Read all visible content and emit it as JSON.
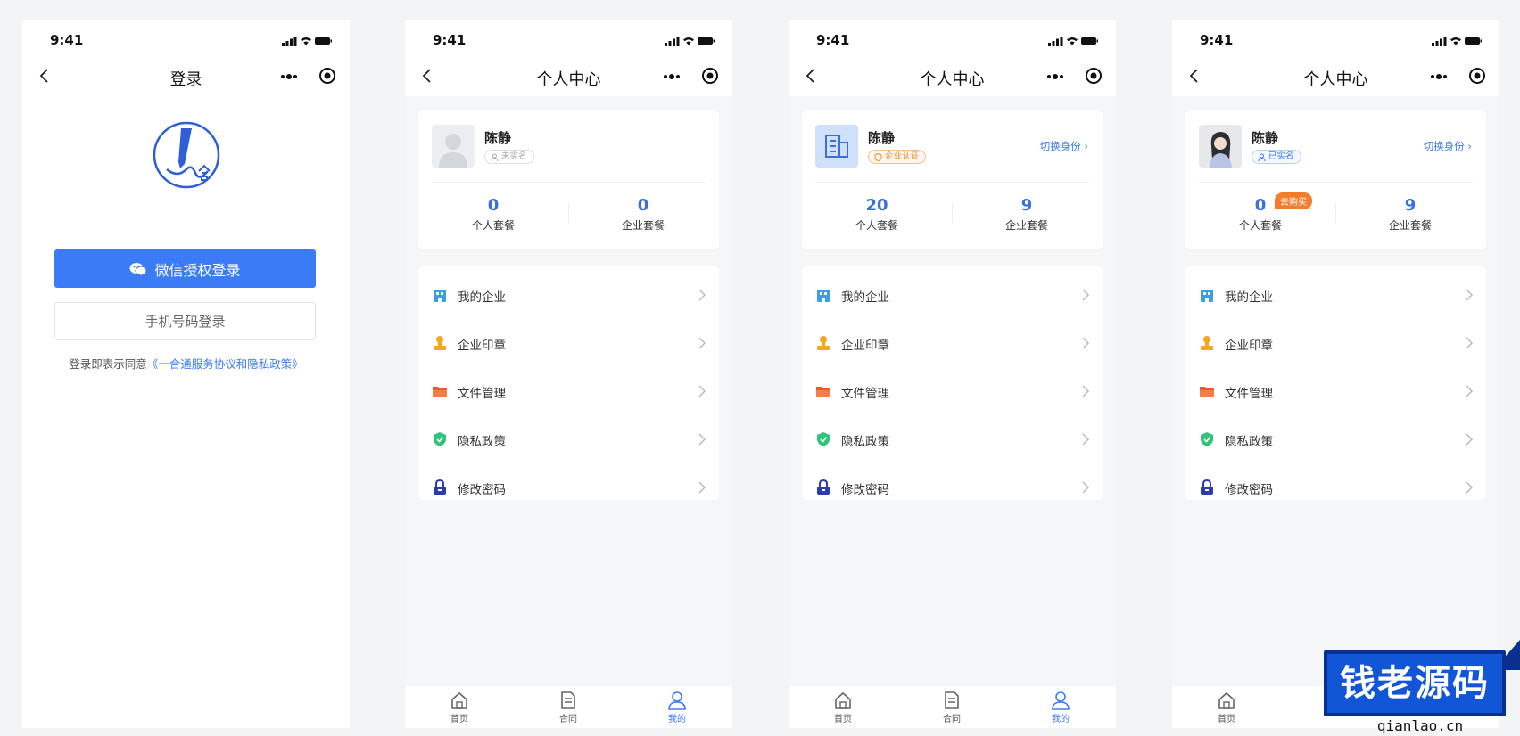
{
  "status": {
    "time": "9:41"
  },
  "screens": {
    "login": {
      "title": "登录",
      "wechat_button": "微信授权登录",
      "phone_button": "手机号码登录",
      "agreement_prefix": "登录即表示同意",
      "agreement_link": "《一合通服务协议和隐私政策》"
    },
    "personal_unverified": {
      "title": "个人中心",
      "name": "陈静",
      "badge": "未实名",
      "stats": [
        {
          "value": "0",
          "label": "个人套餐"
        },
        {
          "value": "0",
          "label": "企业套餐"
        }
      ]
    },
    "personal_enterprise": {
      "title": "个人中心",
      "name": "陈静",
      "badge": "企业认证",
      "switch_label": "切换身份 ›",
      "stats": [
        {
          "value": "20",
          "label": "个人套餐"
        },
        {
          "value": "9",
          "label": "企业套餐"
        }
      ]
    },
    "personal_verified": {
      "title": "个人中心",
      "name": "陈静",
      "badge": "已实名",
      "switch_label": "切换身份 ›",
      "buy_tag": "去购买",
      "stats": [
        {
          "value": "0",
          "label": "个人套餐"
        },
        {
          "value": "9",
          "label": "企业套餐"
        }
      ]
    }
  },
  "menu": [
    {
      "label": "我的企业",
      "icon": "building-icon",
      "color": "#3aa0e6"
    },
    {
      "label": "企业印章",
      "icon": "seal-icon",
      "color": "#f5a623"
    },
    {
      "label": "文件管理",
      "icon": "folder-icon",
      "color": "#f0582a"
    },
    {
      "label": "隐私政策",
      "icon": "shield-icon",
      "color": "#33c27a"
    },
    {
      "label": "修改密码",
      "icon": "lock-icon",
      "color": "#2b3bb0"
    }
  ],
  "tabbar": [
    {
      "label": "首页",
      "icon": "home-icon"
    },
    {
      "label": "合同",
      "icon": "document-icon"
    },
    {
      "label": "我的",
      "icon": "user-icon"
    }
  ],
  "colors": {
    "accent": "#3b7cf6",
    "page_bg": "#f5f6f8"
  },
  "watermark": {
    "title": "钱老源码",
    "site": "qianlao.cn"
  }
}
